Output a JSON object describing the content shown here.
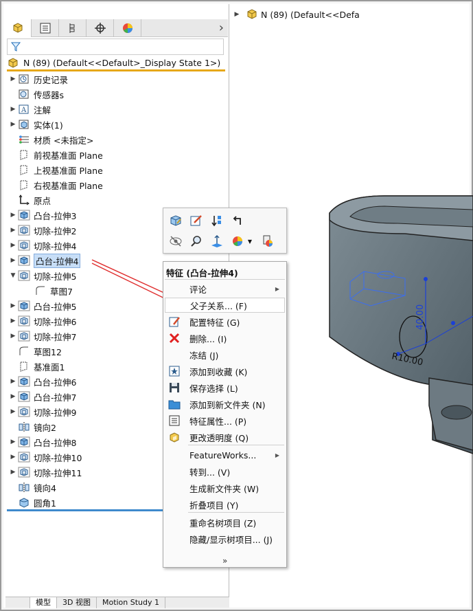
{
  "document": {
    "root_label": "N (89)  (Default<<Default>_Display State 1>)",
    "graphics_label": "N (89)  (Default<<Defa"
  },
  "panel_tabs": [
    "featuremanager-icon",
    "propertymanager-icon",
    "configurationmanager-icon",
    "dimxpert-icon",
    "display-manager-icon"
  ],
  "tree": {
    "items": [
      {
        "label": "历史记录",
        "icon": "history-icon",
        "expand": true
      },
      {
        "label": "传感器s",
        "icon": "sensor-icon",
        "expand": false
      },
      {
        "label": "注解",
        "icon": "annotation-icon",
        "expand": true
      },
      {
        "label": "实体(1)",
        "icon": "solid-body-icon",
        "expand": true
      },
      {
        "label": "材质 <未指定>",
        "icon": "material-icon",
        "expand": false
      },
      {
        "label": "前视基准面 Plane",
        "icon": "plane-icon",
        "expand": false
      },
      {
        "label": "上视基准面 Plane",
        "icon": "plane-icon",
        "expand": false
      },
      {
        "label": "右视基准面 Plane",
        "icon": "plane-icon",
        "expand": false
      },
      {
        "label": "原点",
        "icon": "origin-icon",
        "expand": false
      },
      {
        "label": "凸台-拉伸3",
        "icon": "boss-extrude-icon",
        "expand": true
      },
      {
        "label": "切除-拉伸2",
        "icon": "cut-extrude-icon",
        "expand": true
      },
      {
        "label": "切除-拉伸4",
        "icon": "cut-extrude-icon",
        "expand": true
      },
      {
        "label": "凸台-拉伸4",
        "icon": "boss-extrude-icon",
        "expand": true,
        "selected": true
      },
      {
        "label": "切除-拉伸5",
        "icon": "cut-extrude-icon",
        "expand": "open"
      },
      {
        "label": "草图7",
        "icon": "sketch-icon",
        "expand": false,
        "indent": true
      },
      {
        "label": "凸台-拉伸5",
        "icon": "boss-extrude-icon",
        "expand": true
      },
      {
        "label": "切除-拉伸6",
        "icon": "cut-extrude-icon",
        "expand": true
      },
      {
        "label": "切除-拉伸7",
        "icon": "cut-extrude-icon",
        "expand": true
      },
      {
        "label": "草图12",
        "icon": "sketch-icon",
        "expand": false
      },
      {
        "label": "基准面1",
        "icon": "plane-icon",
        "expand": false
      },
      {
        "label": "凸台-拉伸6",
        "icon": "boss-extrude-icon",
        "expand": true
      },
      {
        "label": "凸台-拉伸7",
        "icon": "boss-extrude-icon",
        "expand": true
      },
      {
        "label": "切除-拉伸9",
        "icon": "cut-extrude-icon",
        "expand": true
      },
      {
        "label": "镜向2",
        "icon": "mirror-icon",
        "expand": false
      },
      {
        "label": "凸台-拉伸8",
        "icon": "boss-extrude-icon",
        "expand": true
      },
      {
        "label": "切除-拉伸10",
        "icon": "cut-extrude-icon",
        "expand": true
      },
      {
        "label": "切除-拉伸11",
        "icon": "cut-extrude-icon",
        "expand": true
      },
      {
        "label": "镜向4",
        "icon": "mirror-icon",
        "expand": false
      },
      {
        "label": "圆角1",
        "icon": "fillet-icon",
        "expand": false
      }
    ]
  },
  "context_toolbar": {
    "row1": [
      "edit-feature-icon",
      "edit-sketch-icon",
      "rollback-icon",
      "parent-child-icon"
    ],
    "row2": [
      "hide-icon",
      "zoom-to-selection-icon",
      "normal-to-icon",
      "appearance-icon",
      "dropdown-icon",
      "appearance-edit-icon"
    ]
  },
  "context_menu": {
    "title": "特征 (凸台-拉伸4)",
    "items": [
      {
        "label": "评论",
        "icon": "",
        "submenu": true
      },
      {
        "label": "父子关系... (F)",
        "icon": "",
        "highlighted": true
      },
      {
        "label": "配置特征 (G)",
        "icon": "configure-feature-icon"
      },
      {
        "label": "删除... (I)",
        "icon": "delete-icon"
      },
      {
        "label": "冻结 (J)",
        "icon": ""
      },
      {
        "label": "添加到收藏 (K)",
        "icon": "favorite-icon"
      },
      {
        "label": "保存选择 (L)",
        "icon": "save-selection-icon"
      },
      {
        "label": "添加到新文件夹 (N)",
        "icon": "folder-icon"
      },
      {
        "label": "特征属性... (P)",
        "icon": "properties-icon"
      },
      {
        "label": "更改透明度 (Q)",
        "icon": "transparency-icon"
      },
      {
        "label": "FeatureWorks...",
        "icon": "",
        "submenu": true
      },
      {
        "label": "转到... (V)",
        "icon": ""
      },
      {
        "label": "生成新文件夹 (W)",
        "icon": ""
      },
      {
        "label": "折叠项目 (Y)",
        "icon": ""
      },
      {
        "label": "重命名树项目 (Z)",
        "icon": ""
      },
      {
        "label": "隐藏/显示树项目... (J)",
        "icon": ""
      }
    ],
    "more_label": "»"
  },
  "model": {
    "dim_vertical": "40.00",
    "dim_radius": "R10.00"
  },
  "bottom_tabs": [
    "模型",
    "3D 视图",
    "Motion Study 1"
  ],
  "colors": {
    "selection": "#c7def7",
    "root_underline": "#e6a819",
    "annotation_arrow": "#e03030",
    "dimension": "#1a3fd8"
  }
}
